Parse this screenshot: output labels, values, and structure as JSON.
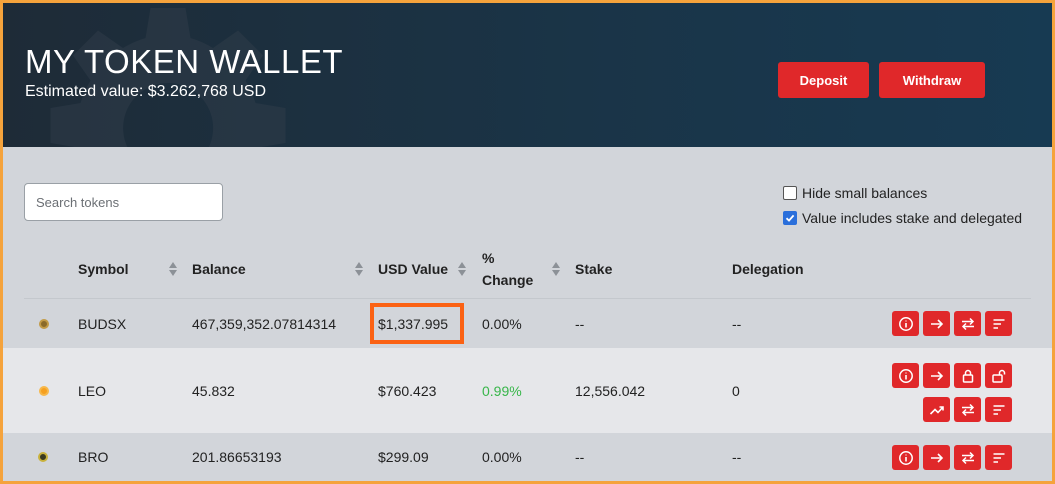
{
  "header": {
    "title": "MY TOKEN WALLET",
    "estimated_value": "Estimated value: $3.262,768 USD",
    "deposit_label": "Deposit",
    "withdraw_label": "Withdraw"
  },
  "search": {
    "placeholder": "Search tokens",
    "value": ""
  },
  "filters": {
    "hide_small_label": "Hide small balances",
    "hide_small_checked": false,
    "include_stake_label": "Value includes stake and delegated",
    "include_stake_checked": true
  },
  "table": {
    "headers": {
      "symbol": "Symbol",
      "balance": "Balance",
      "usd_value": "USD Value",
      "change_line1": "%",
      "change_line2": "Change",
      "stake": "Stake",
      "delegation": "Delegation"
    },
    "rows": [
      {
        "symbol": "BUDSX",
        "balance": "467,359,352.07814314",
        "usd_value": "$1,337.995",
        "change": "0.00%",
        "stake": "--",
        "delegation": "--"
      },
      {
        "symbol": "LEO",
        "balance": "45.832",
        "usd_value": "$760.423",
        "change": "0.99%",
        "stake": "12,556.042",
        "delegation": "0"
      },
      {
        "symbol": "BRO",
        "balance": "201.86653193",
        "usd_value": "$299.09",
        "change": "0.00%",
        "stake": "--",
        "delegation": "--"
      }
    ]
  },
  "colors": {
    "accent_red": "#e0282a",
    "positive_green": "#38b64a",
    "highlight_orange": "#fb6214",
    "border_orange": "#f5a33c"
  }
}
